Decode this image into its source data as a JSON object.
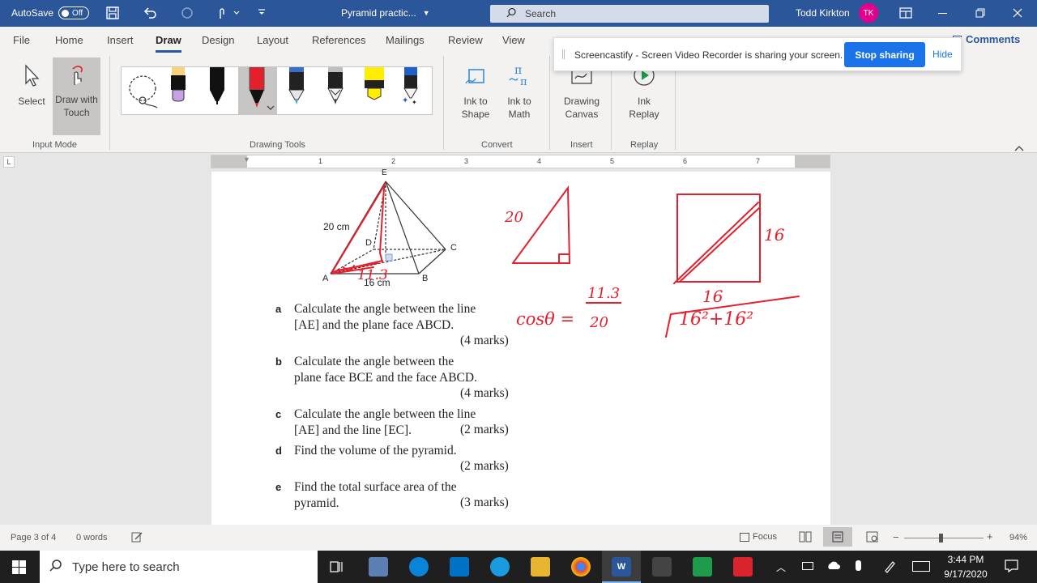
{
  "titlebar": {
    "autosave_label": "AutoSave",
    "autosave_state": "Off",
    "doc_title": "Pyramid practic...",
    "search_placeholder": "Search",
    "user_name": "Todd Kirkton",
    "user_initials": "TK"
  },
  "tabs": [
    "File",
    "Home",
    "Insert",
    "Draw",
    "Design",
    "Layout",
    "References",
    "Mailings",
    "Review",
    "View"
  ],
  "active_tab": "Draw",
  "comments_label": "Comments",
  "ribbon": {
    "select_label": "Select",
    "draw_touch_label_1": "Draw with",
    "draw_touch_label_2": "Touch",
    "input_mode_label": "Input Mode",
    "drawing_tools_label": "Drawing Tools",
    "ink_shape_1": "Ink to",
    "ink_shape_2": "Shape",
    "ink_math_1": "Ink to",
    "ink_math_2": "Math",
    "convert_label": "Convert",
    "drawing_canvas_1": "Drawing",
    "drawing_canvas_2": "Canvas",
    "insert_label": "Insert",
    "ink_replay_1": "Ink",
    "ink_replay_2": "Replay",
    "replay_label": "Replay",
    "pen_colors": [
      "#c8a2e6",
      "#222222",
      "#e3202b",
      "#3aa7c8",
      "#bfbfbf",
      "#ffee00",
      "#1f5fcc"
    ]
  },
  "notification": {
    "message": "Screencastify - Screen Video Recorder is sharing your screen.",
    "stop_label": "Stop sharing",
    "hide_label": "Hide"
  },
  "ruler_numbers": [
    "1",
    "2",
    "3",
    "4",
    "5",
    "6",
    "7"
  ],
  "document": {
    "figure_labels": {
      "edge": "20 cm",
      "base": "16 cm",
      "A": "A",
      "B": "B",
      "C": "C",
      "D": "D",
      "E": "E"
    },
    "ink_annotations": {
      "hyp": "20",
      "half_diag": "11.3",
      "cos_lhs": "cosθ =",
      "cos_num": "11.3",
      "cos_den": "20",
      "side_right": "16",
      "side_bottom": "16",
      "pythag": "16²+16²"
    },
    "questions": [
      {
        "letter": "a",
        "line1": "Calculate the angle between the line",
        "line2": "[AE] and the plane face ABCD.",
        "marks": "(4 marks)"
      },
      {
        "letter": "b",
        "line1": "Calculate the angle between the",
        "line2": "plane face BCE and the face ABCD.",
        "marks": "(4 marks)"
      },
      {
        "letter": "c",
        "line1": "Calculate the angle between the line",
        "line2": "[AE] and the line [EC].",
        "marks": "(2 marks)"
      },
      {
        "letter": "d",
        "line1": "Find the volume of the pyramid.",
        "line2": "",
        "marks": "(2 marks)"
      },
      {
        "letter": "e",
        "line1": "Find the total surface area of the",
        "line2": "pyramid.",
        "marks": "(3 marks)"
      }
    ]
  },
  "statusbar": {
    "page": "Page 3 of 4",
    "words": "0 words",
    "focus": "Focus",
    "zoom": "94%"
  },
  "taskbar": {
    "search_placeholder": "Type here to search",
    "time": "3:44 PM",
    "date": "9/17/2020"
  }
}
